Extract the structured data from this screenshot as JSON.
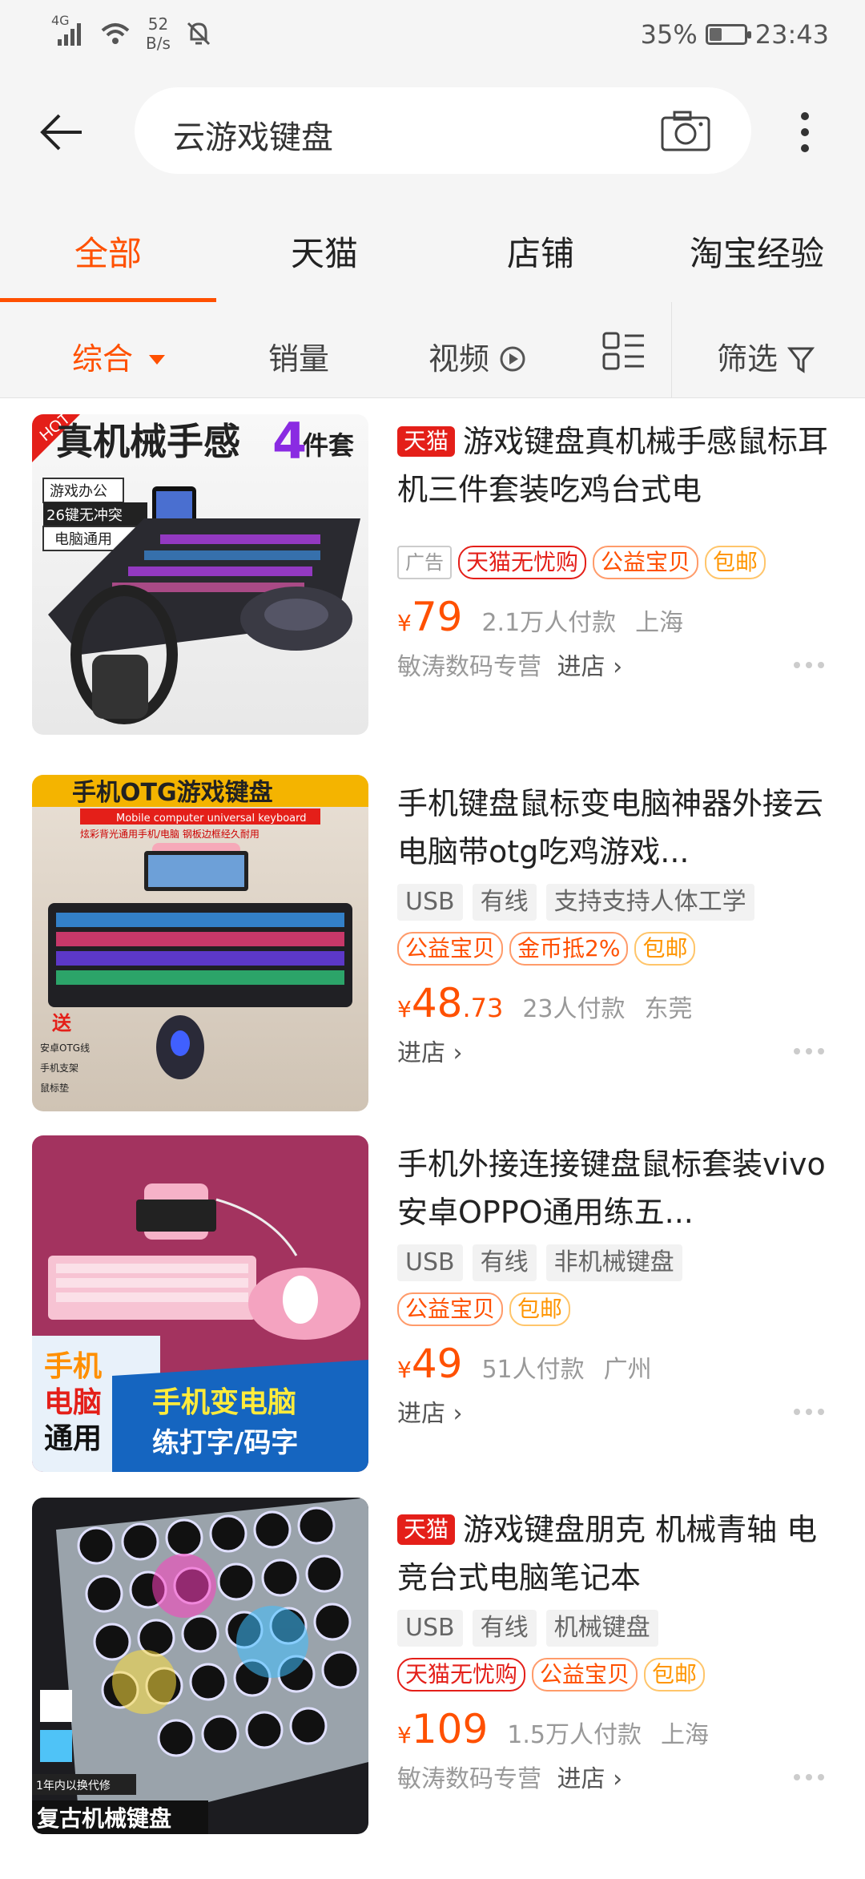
{
  "status_bar": {
    "network": "4G",
    "speed_value": "52",
    "speed_unit": "B/s",
    "battery_percent": "35%",
    "battery_level": 0.35,
    "time": "23:43"
  },
  "search": {
    "query": "云游戏键盘"
  },
  "tabs": [
    {
      "label": "全部"
    },
    {
      "label": "天猫"
    },
    {
      "label": "店铺"
    },
    {
      "label": "淘宝经验"
    }
  ],
  "filters": {
    "comprehensive": "综合",
    "sales": "销量",
    "video": "视频",
    "filter": "筛选"
  },
  "colors": {
    "accent": "#ff5000",
    "tmall_red": "#e41f19",
    "background": "#f5f5f5"
  },
  "products": [
    {
      "tmall_badge": "天猫",
      "title": "游戏键盘真机械手感鼠标耳机三件套装吃鸡台式电",
      "ad_label": "广告",
      "tags": [
        "天猫无忧购",
        "公益宝贝",
        "包邮"
      ],
      "currency": "¥",
      "price": "79",
      "price_decimal": "",
      "sales": "2.1万人付款",
      "location": "上海",
      "shop": "敏涛数码专营",
      "enter_shop": "进店 ›",
      "image": {
        "hot": "HOT",
        "headline": "真机械手感",
        "count": "4",
        "suffix": "件套",
        "box1": "游戏办公",
        "box2": "26键无冲突",
        "box3": "电脑通用"
      }
    },
    {
      "title": "手机键盘鼠标变电脑神器外接云电脑带otg吃鸡游戏...",
      "attrs": [
        "USB",
        "有线",
        "支持支持人体工学"
      ],
      "tags": [
        "公益宝贝",
        "金币抵2%",
        "包邮"
      ],
      "currency": "¥",
      "price": "48",
      "price_decimal": ".73",
      "sales": "23人付款",
      "location": "东莞",
      "enter_shop": "进店 ›",
      "image": {
        "headline": "手机OTG游戏键盘",
        "sub": "Mobile computer universal keyboard",
        "sub2": "炫彩背光通用手机/电脑   钢板边框经久耐用",
        "gift": "送",
        "gift1": "安卓OTG线",
        "gift2": "手机支架",
        "gift3": "鼠标垫"
      }
    },
    {
      "title": "手机外接连接键盘鼠标套装vivo安卓OPPO通用练五...",
      "attrs": [
        "USB",
        "有线",
        "非机械键盘"
      ],
      "tags": [
        "公益宝贝",
        "包邮"
      ],
      "currency": "¥",
      "price": "49",
      "price_decimal": "",
      "sales": "51人付款",
      "location": "广州",
      "enter_shop": "进店 ›",
      "image": {
        "left1": "手机",
        "left2": "电脑",
        "left3": "通用",
        "right1": "手机变电脑",
        "right2": "练打字/码字"
      }
    },
    {
      "tmall_badge": "天猫",
      "title": "游戏键盘朋克 机械青轴 电竞台式电脑笔记本",
      "attrs": [
        "USB",
        "有线",
        "机械键盘"
      ],
      "tags": [
        "天猫无忧购",
        "公益宝贝",
        "包邮"
      ],
      "currency": "¥",
      "price": "109",
      "price_decimal": "",
      "sales": "1.5万人付款",
      "location": "上海",
      "shop": "敏涛数码专营",
      "enter_shop": "进店 ›",
      "image": {
        "warranty": "1年内以换代修",
        "caption": "复古机械键盘"
      }
    }
  ]
}
